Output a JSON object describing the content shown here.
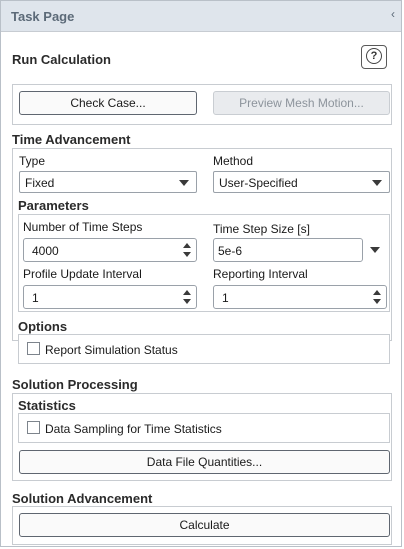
{
  "panel": {
    "title": "Task Page",
    "collapse_glyph": "‹"
  },
  "run_calculation": {
    "heading": "Run Calculation",
    "help_glyph": "?"
  },
  "buttons": {
    "check_case": "Check Case...",
    "preview_mesh_motion": "Preview Mesh Motion...",
    "data_file_quantities": "Data File Quantities...",
    "calculate": "Calculate"
  },
  "time_advancement": {
    "heading": "Time Advancement",
    "type_label": "Type",
    "type_value": "Fixed",
    "method_label": "Method",
    "method_value": "User-Specified"
  },
  "parameters": {
    "heading": "Parameters",
    "num_time_steps_label": "Number of Time Steps",
    "num_time_steps_value": "4000",
    "time_step_size_label": "Time Step Size [s]",
    "time_step_size_value": "5e-6",
    "profile_update_label": "Profile Update Interval",
    "profile_update_value": "1",
    "reporting_interval_label": "Reporting Interval",
    "reporting_interval_value": "1"
  },
  "options": {
    "heading": "Options",
    "report_simulation_status": "Report Simulation Status",
    "report_simulation_status_checked": false
  },
  "solution_processing": {
    "heading": "Solution Processing",
    "statistics_heading": "Statistics",
    "data_sampling": "Data Sampling for Time Statistics",
    "data_sampling_checked": false
  },
  "solution_advancement": {
    "heading": "Solution Advancement"
  }
}
